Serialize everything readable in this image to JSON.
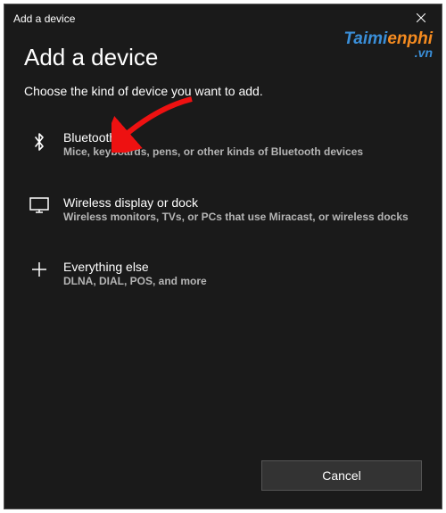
{
  "titlebar": {
    "title": "Add a device"
  },
  "heading": "Add a device",
  "subheading": "Choose the kind of device you want to add.",
  "options": [
    {
      "title": "Bluetooth",
      "desc": "Mice, keyboards, pens, or other kinds of Bluetooth devices"
    },
    {
      "title": "Wireless display or dock",
      "desc": "Wireless monitors, TVs, or PCs that use Miracast, or wireless docks"
    },
    {
      "title": "Everything else",
      "desc": "DLNA, DIAL, POS, and more"
    }
  ],
  "footer": {
    "cancel_label": "Cancel"
  },
  "watermark": {
    "part1": "Taimi",
    "part2": "enphi",
    "suffix": ".vn"
  }
}
